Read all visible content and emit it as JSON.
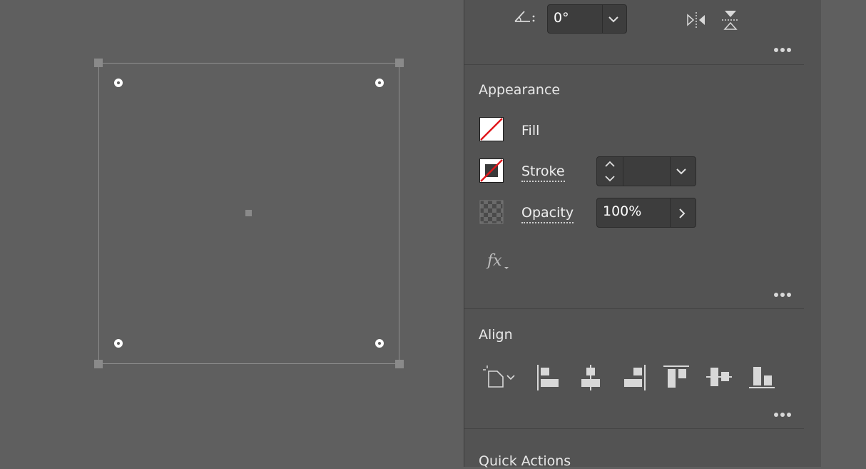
{
  "rotate": {
    "value": "0°"
  },
  "appearance": {
    "title": "Appearance",
    "fill_label": "Fill",
    "stroke_label": "Stroke",
    "stroke_value": "",
    "opacity_label": "Opacity",
    "opacity_value": "100%"
  },
  "align": {
    "title": "Align"
  },
  "quick_actions": {
    "title": "Quick Actions"
  },
  "icons": {
    "rotate": "angle-icon",
    "flip_h": "flip-horizontal-icon",
    "flip_v": "flip-vertical-icon",
    "fx": "fx-icon",
    "align_to": "align-to-icon",
    "align_left": "align-left-icon",
    "align_hcenter": "align-horizontal-center-icon",
    "align_right": "align-right-icon",
    "align_top": "align-top-icon",
    "align_vcenter": "align-vertical-center-icon",
    "align_bottom": "align-bottom-icon"
  },
  "colors": {
    "panel_bg": "#535353",
    "canvas_bg": "#5f5f5f",
    "none_red": "#e0161b"
  }
}
